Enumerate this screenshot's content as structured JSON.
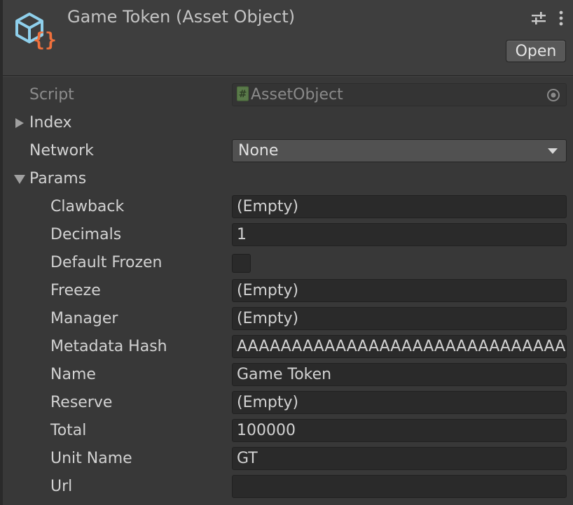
{
  "header": {
    "title": "Game Token (Asset Object)",
    "open_label": "Open",
    "icons": {
      "asset": "asset-object-icon",
      "settings": "sliders-icon",
      "more": "more-vertical-icon"
    }
  },
  "fields": {
    "script": {
      "label": "Script",
      "value": "AssetObject"
    },
    "index": {
      "label": "Index",
      "expanded": false
    },
    "network": {
      "label": "Network",
      "value": "None"
    },
    "params": {
      "label": "Params",
      "expanded": true
    },
    "clawback": {
      "label": "Clawback",
      "value": "(Empty)"
    },
    "decimals": {
      "label": "Decimals",
      "value": "1"
    },
    "default_frozen": {
      "label": "Default Frozen",
      "checked": false
    },
    "freeze": {
      "label": "Freeze",
      "value": "(Empty)"
    },
    "manager": {
      "label": "Manager",
      "value": "(Empty)"
    },
    "metadata_hash": {
      "label": "Metadata Hash",
      "value": "AAAAAAAAAAAAAAAAAAAAAAAAAAAAAAAAAAAAAAAAAAA="
    },
    "name": {
      "label": "Name",
      "value": "Game Token"
    },
    "reserve": {
      "label": "Reserve",
      "value": "(Empty)"
    },
    "total": {
      "label": "Total",
      "value": "100000"
    },
    "unit_name": {
      "label": "Unit Name",
      "value": "GT"
    },
    "url": {
      "label": "Url",
      "value": ""
    }
  },
  "colors": {
    "background": "#383838",
    "header": "#3e3e3e",
    "field": "#2a2a2a",
    "icon_blue": "#8fd0ec",
    "icon_orange": "#f0703c"
  }
}
